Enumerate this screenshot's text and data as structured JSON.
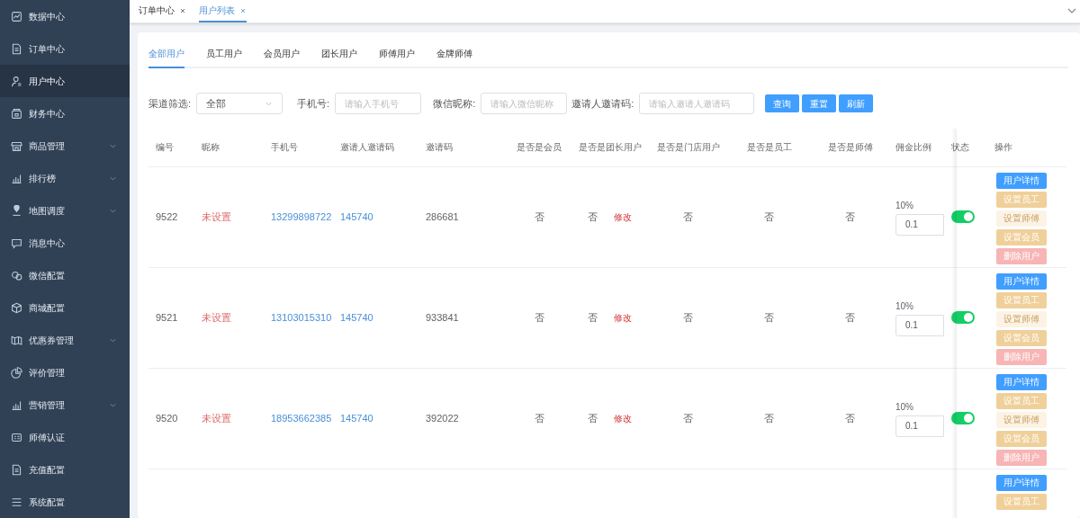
{
  "sidebar": {
    "items": [
      {
        "label": "数据中心",
        "selected": false,
        "expandable": false
      },
      {
        "label": "订单中心",
        "selected": false,
        "expandable": false
      },
      {
        "label": "用户中心",
        "selected": true,
        "expandable": false
      },
      {
        "label": "财务中心",
        "selected": false,
        "expandable": false
      },
      {
        "label": "商品管理",
        "selected": false,
        "expandable": true
      },
      {
        "label": "排行榜",
        "selected": false,
        "expandable": true
      },
      {
        "label": "地图调度",
        "selected": false,
        "expandable": true
      },
      {
        "label": "消息中心",
        "selected": false,
        "expandable": false
      },
      {
        "label": "微信配置",
        "selected": false,
        "expandable": false
      },
      {
        "label": "商城配置",
        "selected": false,
        "expandable": false
      },
      {
        "label": "优惠券管理",
        "selected": false,
        "expandable": true
      },
      {
        "label": "评价管理",
        "selected": false,
        "expandable": false
      },
      {
        "label": "营销管理",
        "selected": false,
        "expandable": true
      },
      {
        "label": "师傅认证",
        "selected": false,
        "expandable": false
      },
      {
        "label": "充值配置",
        "selected": false,
        "expandable": false
      },
      {
        "label": "系统配置",
        "selected": false,
        "expandable": false
      }
    ]
  },
  "page_tabs": [
    {
      "label": "订单中心",
      "selected": false
    },
    {
      "label": "用户列表",
      "selected": true
    }
  ],
  "user_tabs": [
    {
      "label": "全部用户",
      "selected": true
    },
    {
      "label": "员工用户",
      "selected": false
    },
    {
      "label": "会员用户",
      "selected": false
    },
    {
      "label": "团长用户",
      "selected": false
    },
    {
      "label": "师傅用户",
      "selected": false
    },
    {
      "label": "金牌师傅",
      "selected": false
    }
  ],
  "filters": {
    "channel": {
      "label": "渠道筛选:",
      "value": "全部"
    },
    "phone": {
      "label": "手机号:",
      "placeholder": "请输入手机号"
    },
    "nickname": {
      "label": "微信昵称:",
      "placeholder": "请输入微信昵称"
    },
    "inviter_code": {
      "label": "邀请人邀请码:",
      "placeholder": "请输入邀请人邀请码"
    },
    "buttons": [
      "查询",
      "重置",
      "刷新"
    ]
  },
  "table": {
    "columns": [
      "编号",
      "昵称",
      "手机号",
      "邀请人邀请码",
      "邀请码",
      "是否是会员",
      "是否是团长用户",
      "是否是门店用户",
      "是否是员工",
      "是否是师傅",
      "佣金比例",
      "状态",
      "操作"
    ],
    "rows": [
      {
        "id": "9522",
        "nickname": "未设置",
        "phone": "13299898722",
        "inviter_code": "145740",
        "invite_code": "286681",
        "is_member": "否",
        "is_leader": "否",
        "edit_link": "修改",
        "is_store": "否",
        "is_staff": "否",
        "is_master": "否",
        "commission_label": "10%",
        "commission_value": "0.1",
        "status_on": true,
        "actions": [
          {
            "label": "用户详情",
            "kind": "primary",
            "disabled": false
          },
          {
            "label": "设置员工",
            "kind": "warning",
            "disabled": false
          },
          {
            "label": "设置师傅",
            "kind": "warning",
            "disabled": true
          },
          {
            "label": "设置会员",
            "kind": "warning",
            "disabled": false
          },
          {
            "label": "删除用户",
            "kind": "danger",
            "disabled": false
          }
        ]
      },
      {
        "id": "9521",
        "nickname": "未设置",
        "phone": "13103015310",
        "inviter_code": "145740",
        "invite_code": "933841",
        "is_member": "否",
        "is_leader": "否",
        "edit_link": "修改",
        "is_store": "否",
        "is_staff": "否",
        "is_master": "否",
        "commission_label": "10%",
        "commission_value": "0.1",
        "status_on": true,
        "actions": [
          {
            "label": "用户详情",
            "kind": "primary",
            "disabled": false
          },
          {
            "label": "设置员工",
            "kind": "warning",
            "disabled": false
          },
          {
            "label": "设置师傅",
            "kind": "warning",
            "disabled": true
          },
          {
            "label": "设置会员",
            "kind": "warning",
            "disabled": false
          },
          {
            "label": "删除用户",
            "kind": "danger",
            "disabled": false
          }
        ]
      },
      {
        "id": "9520",
        "nickname": "未设置",
        "phone": "18953662385",
        "inviter_code": "145740",
        "invite_code": "392022",
        "is_member": "否",
        "is_leader": "否",
        "edit_link": "修改",
        "is_store": "否",
        "is_staff": "否",
        "is_master": "否",
        "commission_label": "10%",
        "commission_value": "0.1",
        "status_on": true,
        "actions": [
          {
            "label": "用户详情",
            "kind": "primary",
            "disabled": false
          },
          {
            "label": "设置员工",
            "kind": "warning",
            "disabled": false
          },
          {
            "label": "设置师傅",
            "kind": "warning",
            "disabled": true
          },
          {
            "label": "设置会员",
            "kind": "warning",
            "disabled": false
          },
          {
            "label": "删除用户",
            "kind": "danger",
            "disabled": false
          }
        ]
      },
      {
        "actions": [
          {
            "label": "用户详情",
            "kind": "primary",
            "disabled": false
          },
          {
            "label": "设置员工",
            "kind": "warning",
            "disabled": false
          }
        ]
      }
    ]
  }
}
